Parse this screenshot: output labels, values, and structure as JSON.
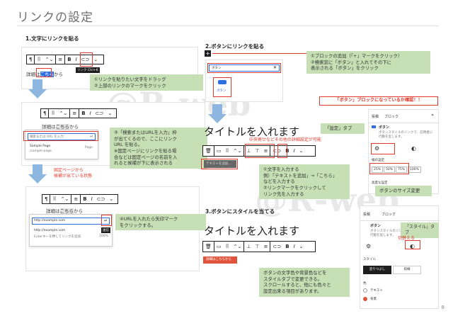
{
  "page": {
    "title": "リンクの設定",
    "number": "8"
  },
  "watermark": "@R-web",
  "s1": {
    "heading": "1.文字にリンクを貼る",
    "tb_buttons": [
      "¶",
      "⠿",
      "⌃⌄",
      "≡",
      "B",
      "I",
      "⊂⊃",
      "⌄"
    ],
    "tooltip": "リンク Ctrl+K",
    "sample_text_pre": "詳細は",
    "sample_text_hl": "こちら",
    "sample_text_post": "から",
    "note1": [
      "①リンクを貼りたい文字をドラッグ",
      "②上部のリンクのマークをクリック"
    ],
    "search_placeholder": "検索または URL を入力",
    "sugg_title": "Sample Page",
    "sugg_url": "/sample-page",
    "sugg_type": "Page",
    "note3": [
      "③「検索またはURLを入力」枠",
      "が出てくるので、ここにリンク",
      "URL を貼る。",
      "※固定ページにリンクを貼る場",
      "合などは固定ページの名前を入",
      "れると候補が下に表示される"
    ],
    "red_note": [
      "固定ページから",
      "候補が出ている状態"
    ],
    "url_value": "http://example.com",
    "url_display": "http://example.com",
    "url_hint": "Enterキーを押してリンクを追加",
    "url_pct": "100%",
    "submit_label": "送信",
    "note4": [
      "④URLを入れたら矢印マーク",
      "をクリックする。"
    ]
  },
  "s2": {
    "heading": "2.ボタンにリンクを貼る",
    "plus": "+",
    "search_value": "ボタン",
    "block_label": "ボタン",
    "note": [
      "①ブロックの追加（「+」マークをクリック）",
      "②検索窓に「ボタン」と入れてその下に",
      "表示される「ボタン」をクリック"
    ],
    "title_text": "タイトルを入れます",
    "red_mid": "中央寄せなどその他の詳細設定が可能",
    "button_placeholder": "テキストを追加…",
    "note2": [
      "①文字を入力する",
      "例）「テキストを追加」→「こちら」",
      "などを入力する",
      "②リンクマークをクリックして",
      "リンク先を入力する"
    ]
  },
  "s3": {
    "heading": "3.ボタンにスタイルを当てる",
    "title_text": "タイトルを入れます",
    "button_label": "詳細はこちらから",
    "note": [
      "ボタンの文字色や背景色などを",
      "スタイルタブで変更できる。",
      "スクロールすると、他にも色々と",
      "設定出来る項目があります。"
    ]
  },
  "panel": {
    "red_title": "「ボタン」ブロックになっているか確認！！",
    "tabs": [
      "投稿",
      "ブロック"
    ],
    "close": "✕",
    "block_name": "ボタン",
    "block_desc": [
      "ボタンスタイルのリンクで、訪問者に",
      "行動を促します。"
    ],
    "settings_note": "「設定」タブ",
    "width_label": "幅の設定",
    "widths": [
      "25%",
      "50%",
      "75%",
      "100%"
    ],
    "adv_label": "高度な設定",
    "size_note": "ボタンのサイズ変更",
    "p2_tabs": [
      "投稿",
      "ブロック"
    ],
    "p2_block": "ボタン",
    "p2_desc": [
      "ボタンスタイルのリンクで、訪問者に",
      "行動を促します。"
    ],
    "style_note": "「スタイル」タブ",
    "switch_red": "切替える",
    "style_label": "スタイル",
    "style_opts": [
      "塗りつぶし",
      "枠線"
    ],
    "color_label": "色",
    "text_label": "テキスト",
    "bg_label": "背景"
  },
  "colors": {
    "note_green": "#c6dfb4",
    "red": "#e23a2c",
    "blue_arrow": "#8db6e1",
    "dark": "#1e1e1e",
    "btn_orange": "#e0543c"
  }
}
